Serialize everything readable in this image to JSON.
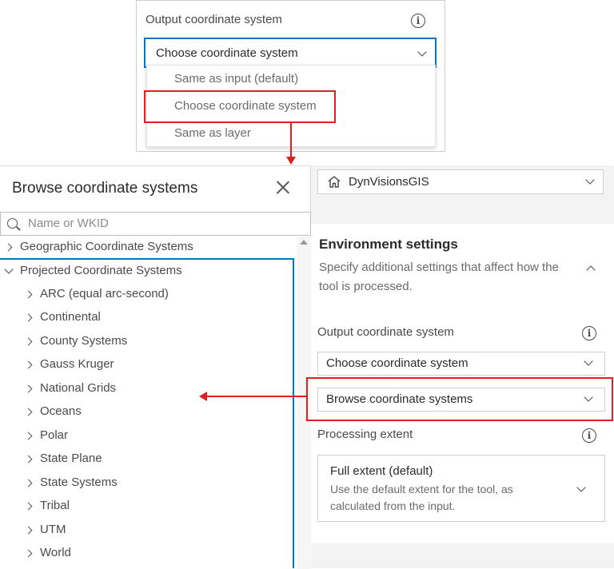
{
  "top_dropdown": {
    "label": "Output coordinate system",
    "selected": "Choose coordinate system",
    "options": [
      "Same as input (default)",
      "Choose coordinate system",
      "Same as layer"
    ]
  },
  "browse_panel": {
    "title": "Browse coordinate systems",
    "search_placeholder": "Name or WKID",
    "tree": {
      "geographic": "Geographic Coordinate Systems",
      "projected": "Projected Coordinate Systems",
      "projected_children": [
        "ARC (equal arc-second)",
        "Continental",
        "County Systems",
        "Gauss Kruger",
        "National Grids",
        "Oceans",
        "Polar",
        "State Plane",
        "State Systems",
        "Tribal",
        "UTM",
        "World"
      ]
    }
  },
  "right_panel": {
    "portal": "DynVisionsGIS",
    "env_title": "Environment settings",
    "env_desc": "Specify additional settings that affect how the tool is processed.",
    "output_cs_label": "Output coordinate system",
    "output_cs_value": "Choose coordinate system",
    "browse_value": "Browse coordinate systems",
    "extent_label": "Processing extent",
    "extent_title": "Full extent (default)",
    "extent_desc": "Use the default extent for the tool, as calculated from the input."
  },
  "colors": {
    "highlight_red": "#e02020",
    "accent_blue": "#0079c1"
  },
  "icons": {
    "info": "i"
  }
}
